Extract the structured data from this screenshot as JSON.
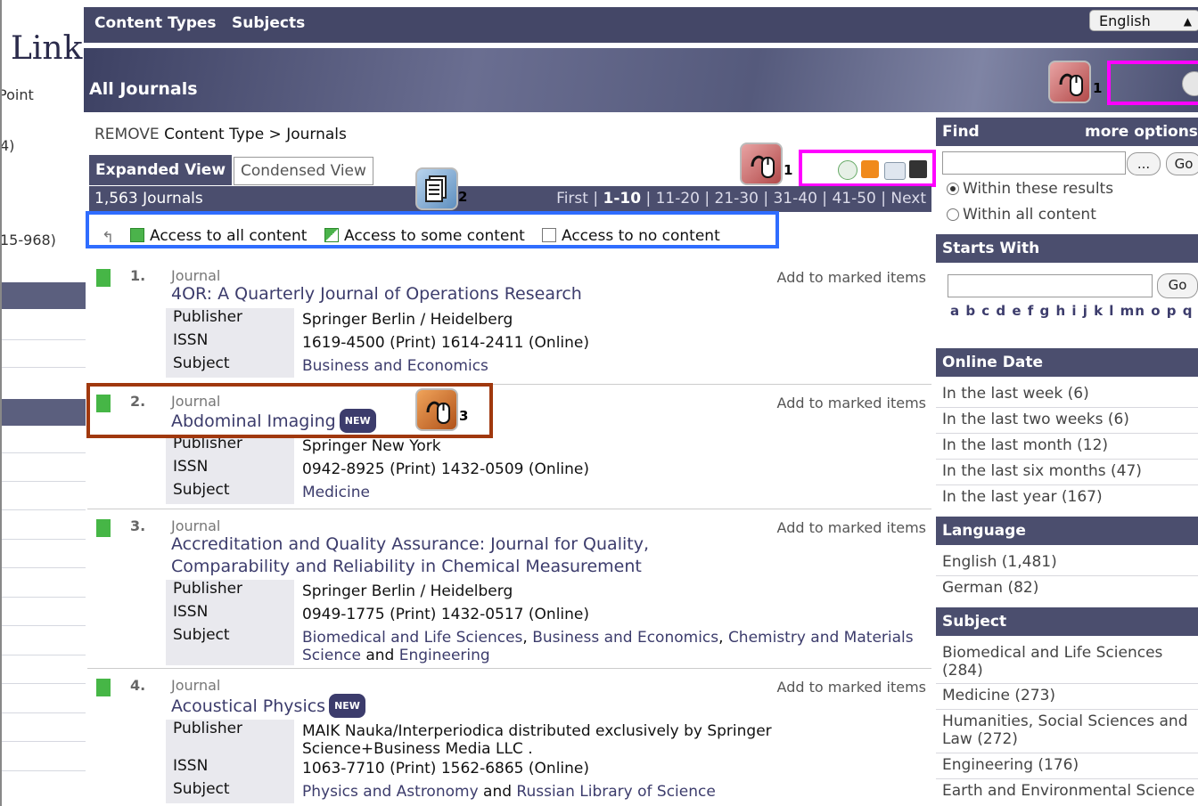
{
  "left": {
    "logo": "Link",
    "subtitle": "Point",
    "frag1": "4)",
    "frag2": "15-968)"
  },
  "topnav": {
    "content_types": "Content Types",
    "subjects": "Subjects",
    "language": "English"
  },
  "banner": {
    "title": "All Journals"
  },
  "annotations": {
    "num1": "1",
    "num2": "2",
    "num3": "3"
  },
  "breadcrumb": {
    "remove": "REMOVE",
    "path": "Content Type > Journals"
  },
  "tabs": {
    "expanded": "Expanded View",
    "condensed": "Condensed View"
  },
  "results": {
    "count": "1,563 Journals",
    "pager": {
      "first": "First",
      "current": "1-10",
      "p2": "11-20",
      "p3": "21-30",
      "p4": "31-40",
      "p5": "41-50",
      "next": "Next",
      "sep": "|"
    }
  },
  "legend": {
    "all": "Access to all content",
    "some": "Access to some content",
    "none": "Access to no content"
  },
  "labels": {
    "journal": "Journal",
    "add": "Add to marked items",
    "publisher": "Publisher",
    "issn": "ISSN",
    "subject": "Subject",
    "new": "NEW"
  },
  "journals": [
    {
      "index": "1.",
      "title": "4OR: A Quarterly Journal of Operations Research",
      "publisher": "Springer Berlin / Heidelberg",
      "issn": "1619-4500 (Print) 1614-2411 (Online)",
      "subject": "Business and Economics"
    },
    {
      "index": "2.",
      "title": "Abdominal Imaging",
      "publisher": "Springer New York",
      "issn": "0942-8925 (Print) 1432-0509 (Online)",
      "subject": "Medicine"
    },
    {
      "index": "3.",
      "title": "Accreditation and Quality Assurance: Journal for Quality, Comparability and Reliability in Chemical Measurement",
      "publisher": "Springer Berlin / Heidelberg",
      "issn": "0949-1775 (Print) 1432-0517 (Online)",
      "subject_a": "Biomedical and Life Sciences",
      "subject_b": "Business and Economics",
      "subject_c": "Chemistry and Materials Science",
      "subject_and": "and",
      "subject_d": "Engineering"
    },
    {
      "index": "4.",
      "title": "Acoustical Physics",
      "publisher": "MAIK Nauka/Interperiodica distributed exclusively by Springer Science+Business Media LLC .",
      "issn": "1063-7710 (Print) 1562-6865 (Online)",
      "subject_a": "Physics and Astronomy",
      "subject_and": "and",
      "subject_b": "Russian Library of Science"
    }
  ],
  "sidebar": {
    "find": "Find",
    "more_options": "more options",
    "ellipsis": "...",
    "go": "Go",
    "within_results": "Within these results",
    "within_all": "Within all content",
    "starts_with": "Starts With",
    "letters": "a b c d e f g h i j k l mn o p q",
    "online_date": "Online Date",
    "dates": [
      "In the last week (6)",
      "In the last two weeks (6)",
      "In the last month (12)",
      "In the last six months (47)",
      "In the last year (167)"
    ],
    "language": "Language",
    "languages": [
      "English (1,481)",
      "German (82)"
    ],
    "subject": "Subject",
    "subjects": [
      "Biomedical and Life Sciences (284)",
      "Medicine (273)",
      "Humanities, Social Sciences and Law (272)",
      "Engineering (176)",
      "Earth and Environmental Science"
    ]
  }
}
